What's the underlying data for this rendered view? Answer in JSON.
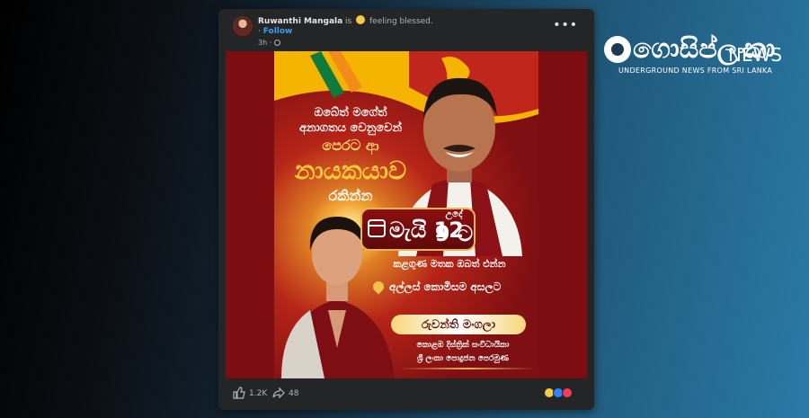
{
  "post": {
    "author": "Ruwanthi Mangala",
    "status_prefix": "is",
    "status_text": "feeling blessed.",
    "follow_label": "Follow",
    "time": "3h",
    "likes": "1.2K",
    "shares": "48"
  },
  "poster": {
    "slogan_line1": "ඔබේත් මගේත්",
    "slogan_line2": "අනාගතය වෙනුවෙන්",
    "slogan_line3": "පෙරට ආ",
    "slogan_line4": "නායකයාව",
    "slogan_line5": "රකින්න",
    "date": "මැයි 12",
    "time_label": "උදේ",
    "time_value": "9 ට",
    "invite": "කළගුණ මතක ඔබත් එන්න",
    "location": "අල්ලස් කොමිසම අසලට",
    "name": "රුවන්ති මංගලා",
    "subtitle1": "කොළඹ දිස්ත්‍රික් සංවිධායිකා",
    "subtitle2": "ශ්‍රී ලංකා පොදුජන පෙරමුණ"
  },
  "brand": {
    "name": "ගොසිප්ලංකා",
    "news": "NEWS",
    "tagline": "UNDERGROUND NEWS FROM SRI LANKA"
  },
  "colors": {
    "background_left": "#000000",
    "background_right": "#2a7aa6",
    "card": "#242526",
    "poster_red": "#7c0e12",
    "gold": "#e7b450",
    "link_blue": "#3a9cf0"
  },
  "icons": [
    "more-icon",
    "globe-icon",
    "like-icon",
    "share-icon",
    "calendar-icon",
    "location-pin-icon"
  ]
}
